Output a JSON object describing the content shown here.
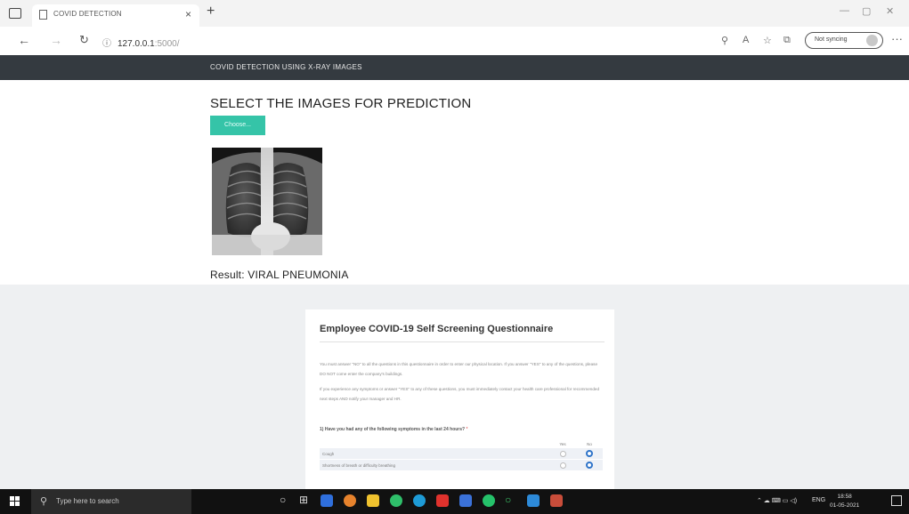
{
  "browser": {
    "tab_title": "COVID DETECTION",
    "tab_close": "×",
    "new_tab": "+",
    "url_host": "127.0.0.1",
    "url_port": ":5000/",
    "sync_label": "Not syncing",
    "more": "···"
  },
  "navbar": {
    "brand": "COVID DETECTION USING X-RAY IMAGES"
  },
  "main": {
    "heading": "SELECT THE IMAGES FOR PREDICTION",
    "choose_button": "Choose...",
    "result": "Result: VIRAL PNEUMONIA"
  },
  "questionnaire": {
    "title": "Employee COVID-19 Self Screening Questionnaire",
    "intro_1": "You must answer \"NO\" to all the questions in this questionnaire in order to enter our physical location. If you answer \"YES\" to any of the questions, please DO NOT come enter the company's buildings.",
    "intro_2": "If you experience any symptoms or answer \"YES\" to any of these questions, you must immediately contact your health care professional for recommended next steps AND notify your manager and HR.",
    "question": "1) Have you had any of the following symptoms in the last 24 hours?",
    "required_marker": "*",
    "col_yes": "Yes",
    "col_no": "No",
    "rows": [
      {
        "label": "Cough",
        "selected": "No"
      },
      {
        "label": "Shortness of breath or difficulty breathing",
        "selected": "No"
      }
    ]
  },
  "taskbar": {
    "search_placeholder": "Type here to search",
    "lang": "ENG",
    "time": "18:58",
    "date": "01-05-2021"
  },
  "colors": {
    "navbar": "#343a40",
    "choose_button": "#35c4a8",
    "radio_selected": "#2f74c9",
    "page_bottom": "#eef0f2"
  }
}
